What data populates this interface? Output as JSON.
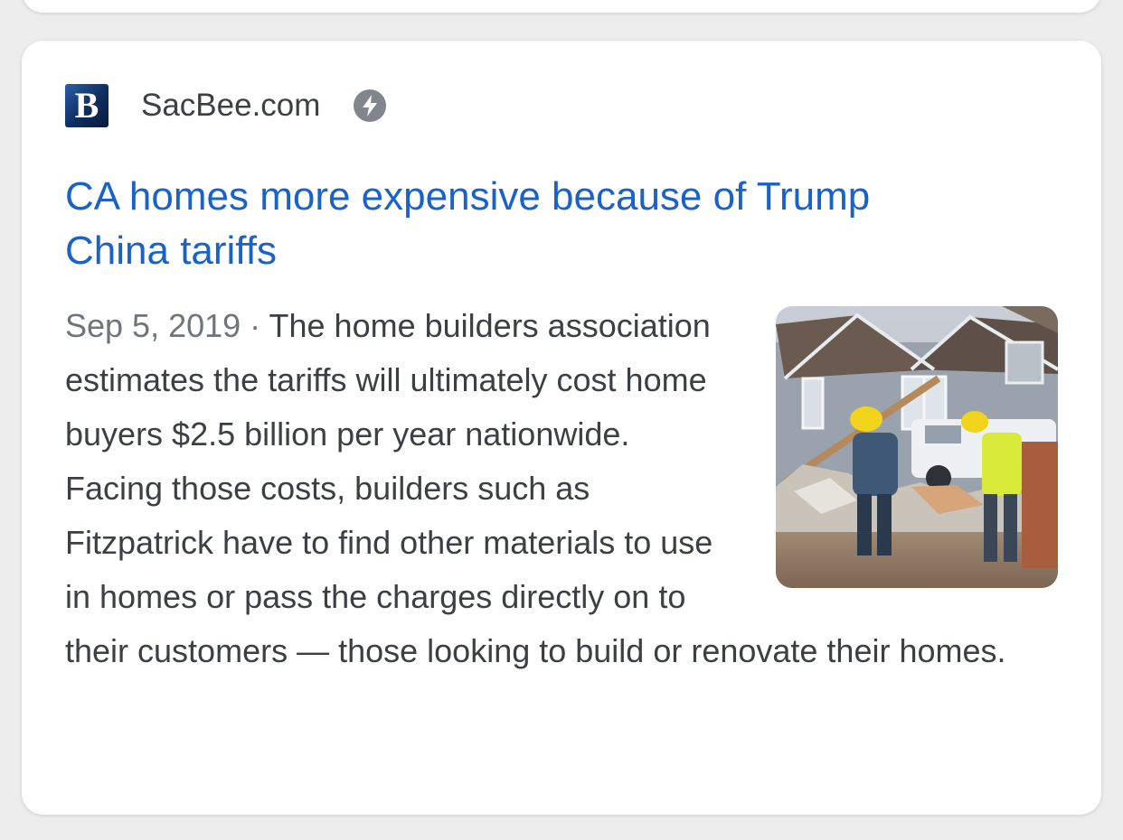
{
  "result": {
    "source_name": "SacBee.com",
    "favicon_letter": "B",
    "title": "CA homes more expensive because of Trump China tariffs",
    "date": "Sep 5, 2019",
    "separator": " · ",
    "snippet": "The home builders association estimates the tariffs will ultimately cost home buyers $2.5 billion per year nationwide. Facing those costs, builders such as Fitzpatrick have to find other materials to use in homes or pass the charges directly on to their customers — those looking to build or renovate their homes.",
    "title_color": "#1a62c7",
    "text_color": "#3c4043",
    "date_color": "#70757a",
    "icons": {
      "favicon": "sacbee-favicon",
      "amp": "amp-lightning-icon"
    }
  }
}
